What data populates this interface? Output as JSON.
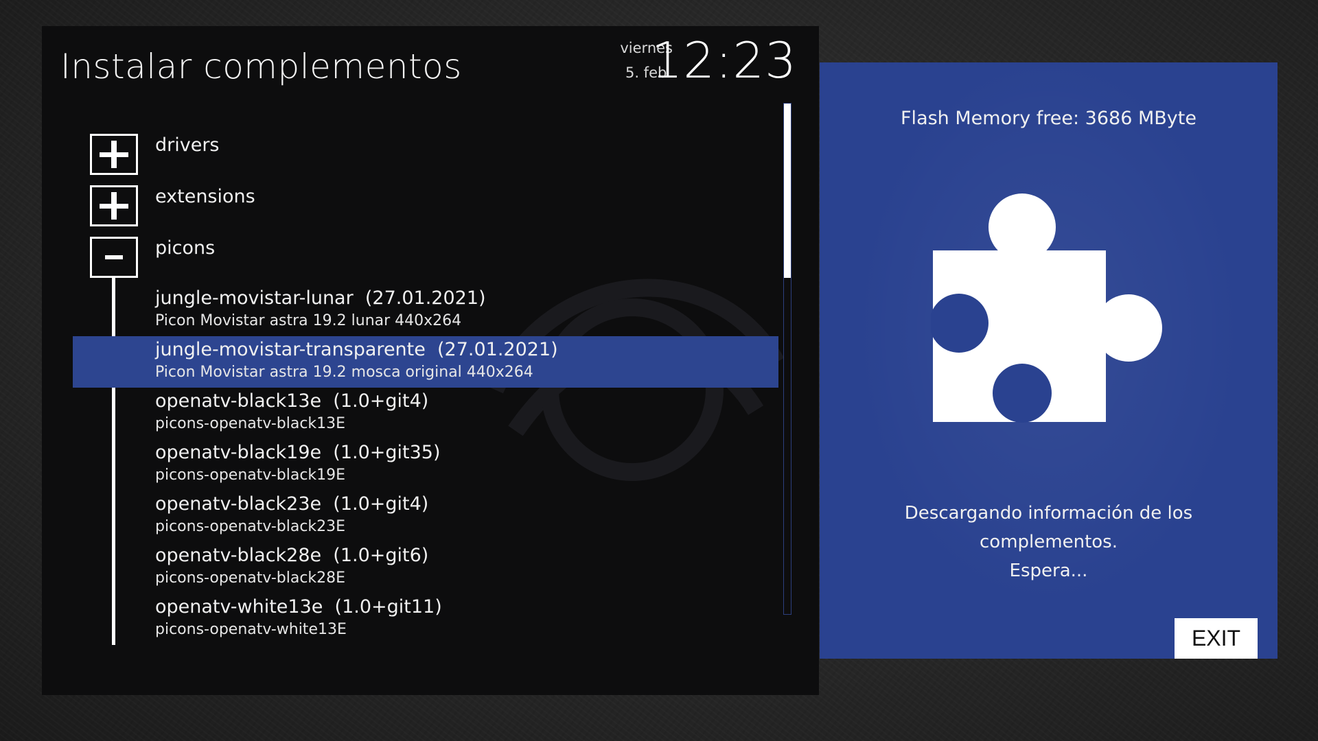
{
  "header": {
    "title": "Instalar complementos",
    "clock": {
      "day": "viernes",
      "date": "5. feb.",
      "time": "12:23"
    }
  },
  "list": {
    "categories": [
      {
        "label": "drivers",
        "expanded": false,
        "icon": "plus-icon"
      },
      {
        "label": "extensions",
        "expanded": false,
        "icon": "plus-icon"
      },
      {
        "label": "picons",
        "expanded": true,
        "icon": "minus-icon"
      }
    ],
    "packages": [
      {
        "name": "jungle-movistar-lunar  (27.01.2021)",
        "description": "Picon Movistar astra 19.2 lunar 440x264",
        "selected": false
      },
      {
        "name": "jungle-movistar-transparente  (27.01.2021)",
        "description": "Picon Movistar astra 19.2 mosca original 440x264",
        "selected": true
      },
      {
        "name": "openatv-black13e  (1.0+git4)",
        "description": "picons-openatv-black13E",
        "selected": false
      },
      {
        "name": "openatv-black19e  (1.0+git35)",
        "description": "picons-openatv-black19E",
        "selected": false
      },
      {
        "name": "openatv-black23e  (1.0+git4)",
        "description": "picons-openatv-black23E",
        "selected": false
      },
      {
        "name": "openatv-black28e  (1.0+git6)",
        "description": "picons-openatv-black28E",
        "selected": false
      },
      {
        "name": "openatv-white13e  (1.0+git11)",
        "description": "picons-openatv-white13E",
        "selected": false
      }
    ]
  },
  "info": {
    "flash_memory": "Flash Memory free: 3686 MByte",
    "icon": "puzzle-piece-icon",
    "status_line1": "Descargando información de los complementos.",
    "status_line2": "Espera...",
    "exit_label": "EXIT"
  },
  "colors": {
    "panel_bg": "#0d0d0e",
    "selection": "#2d4590",
    "info_bg": "#2a4290",
    "text": "#f0f0f0"
  }
}
